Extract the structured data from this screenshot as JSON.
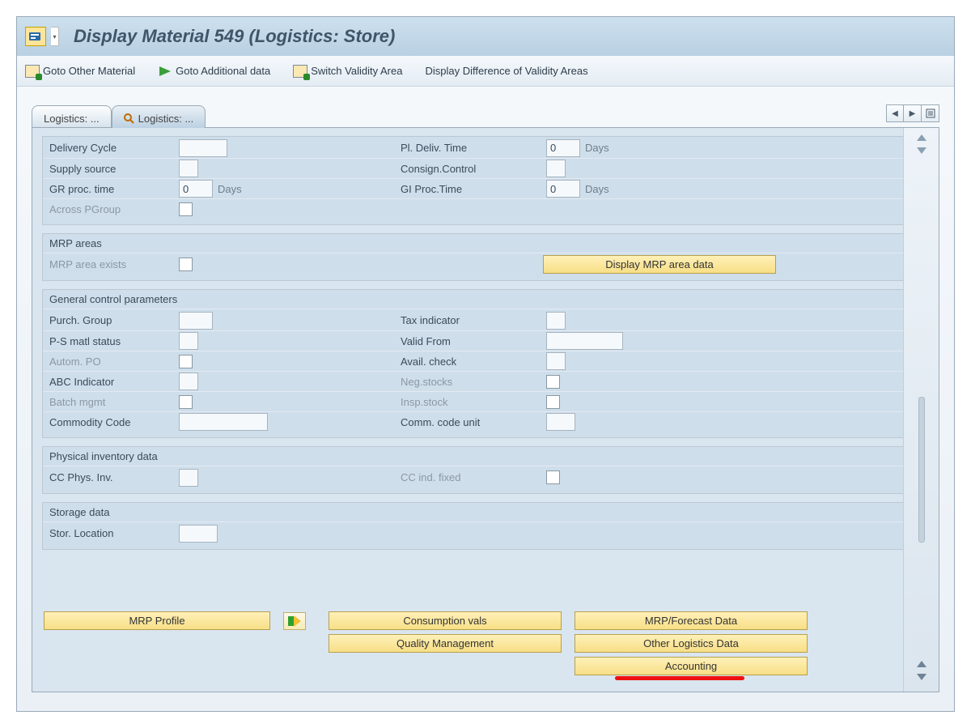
{
  "title": "Display Material 549 (Logistics: Store)",
  "toolbar": {
    "goto_other": "Goto Other Material",
    "goto_additional": "Goto Additional data",
    "switch_validity": "Switch Validity Area",
    "display_diff": "Display Difference of Validity Areas"
  },
  "tabs": {
    "t1": "Logistics: ...",
    "t2": "Logistics: ..."
  },
  "top_group": {
    "delivery_cycle": "Delivery Cycle",
    "supply_source": "Supply source",
    "gr_proc_time": "GR proc. time",
    "gr_proc_time_val": "0",
    "gr_proc_time_unit": "Days",
    "across_pgroup": "Across PGroup",
    "pl_deliv_time": "Pl. Deliv. Time",
    "pl_deliv_time_val": "0",
    "pl_deliv_time_unit": "Days",
    "consign_control": "Consign.Control",
    "gi_proc_time": "GI Proc.Time",
    "gi_proc_time_val": "0",
    "gi_proc_time_unit": "Days"
  },
  "mrp_group": {
    "title": "MRP areas",
    "mrp_area_exists": "MRP area exists",
    "display_btn": "Display MRP area data"
  },
  "gcp": {
    "title": "General control parameters",
    "purch_group": "Purch. Group",
    "ps_matl_status": "P-S matl status",
    "autom_po": "Autom. PO",
    "abc_indicator": "ABC Indicator",
    "batch_mgmt": "Batch mgmt",
    "commodity_code": "Commodity Code",
    "tax_indicator": "Tax indicator",
    "valid_from": "Valid From",
    "avail_check": "Avail. check",
    "neg_stocks": "Neg.stocks",
    "insp_stock": "Insp.stock",
    "comm_code_unit": "Comm. code unit"
  },
  "pid": {
    "title": "Physical inventory data",
    "cc_phys_inv": "CC Phys. Inv.",
    "cc_ind_fixed": "CC ind. fixed"
  },
  "sd": {
    "title": "Storage data",
    "stor_location": "Stor. Location"
  },
  "bottom": {
    "mrp_profile": "MRP Profile",
    "consumption_vals": "Consumption vals",
    "quality_mgmt": "Quality Management",
    "mrp_forecast": "MRP/Forecast Data",
    "other_logistics": "Other Logistics Data",
    "accounting": "Accounting"
  }
}
